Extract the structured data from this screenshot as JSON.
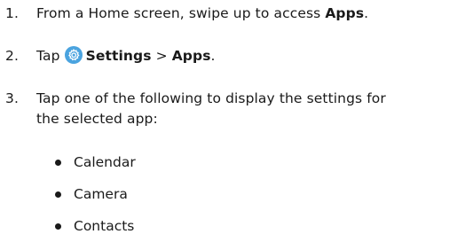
{
  "steps": [
    {
      "number": "1.",
      "text_before": "From a Home screen, swipe up to access ",
      "bold": "Apps",
      "text_after": "."
    },
    {
      "number": "2.",
      "text_before": "Tap ",
      "icon": "settings-gear-icon",
      "bold1": "Settings",
      "separator": " > ",
      "bold2": "Apps",
      "text_after": "."
    },
    {
      "number": "3.",
      "line1": "Tap one of the following to display the settings for",
      "line2": "the selected app:"
    }
  ],
  "apps": [
    "Calendar",
    "Camera",
    "Contacts"
  ],
  "colors": {
    "text": "#1a1a1a",
    "icon_bg": "#4aa3df",
    "icon_fg": "#ffffff"
  }
}
